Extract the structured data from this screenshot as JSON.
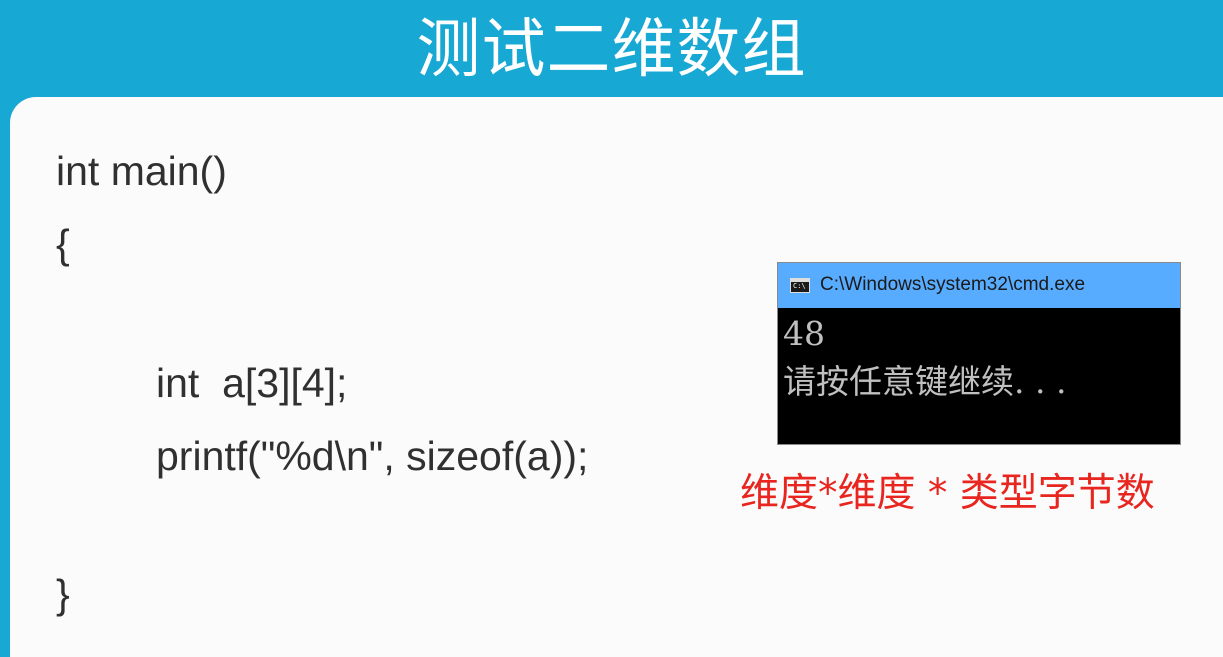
{
  "slide": {
    "title": "测试二维数组"
  },
  "code": {
    "lines": [
      "int main()",
      "{",
      "int  a[3][4];",
      "printf(\"%d\\n\", sizeof(a));",
      "}"
    ]
  },
  "console": {
    "window_title": "C:\\Windows\\system32\\cmd.exe",
    "output_value": "48",
    "output_prompt": "请按任意键继续. . ."
  },
  "annotation": {
    "text": "维度*维度 * 类型字节数",
    "color": "#e8251f"
  },
  "colors": {
    "title_background": "#17a8d4",
    "card_background": "#fbfbfb",
    "cmd_titlebar": "#58acff",
    "cmd_background": "#000000"
  }
}
